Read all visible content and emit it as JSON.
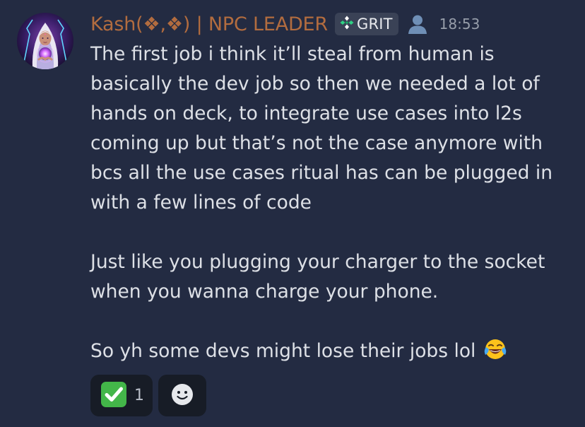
{
  "author": {
    "name": "Kash(❖,❖) | NPC LEADER",
    "role_tag": "GRIT",
    "role_tag_icon": "diamond-badge-icon",
    "status_icon": "person-icon",
    "timestamp": "18:53",
    "colors": {
      "name": "#b26c3f",
      "tag_bg": "#3a4256"
    }
  },
  "message": {
    "paragraphs": [
      "The first job i think  it’ll steal from human is basically the dev job so then we needed a lot of hands on deck, to integrate use cases into l2s coming up but that’s not the case anymore with bcs  all the use cases ritual has can be plugged in with a few lines of code",
      "Just like you plugging your charger to the socket when you wanna charge your phone.",
      "So yh some devs might lose their jobs lol"
    ],
    "trailing_emoji": "face-with-tears-of-joy-icon"
  },
  "reactions": [
    {
      "emoji": "check-mark-button-icon",
      "count": "1"
    },
    {
      "emoji": "add-reaction-smiley-icon"
    }
  ],
  "colors": {
    "background": "#232b42",
    "text": "#dde0e6",
    "reaction_bg": "#171c26"
  }
}
